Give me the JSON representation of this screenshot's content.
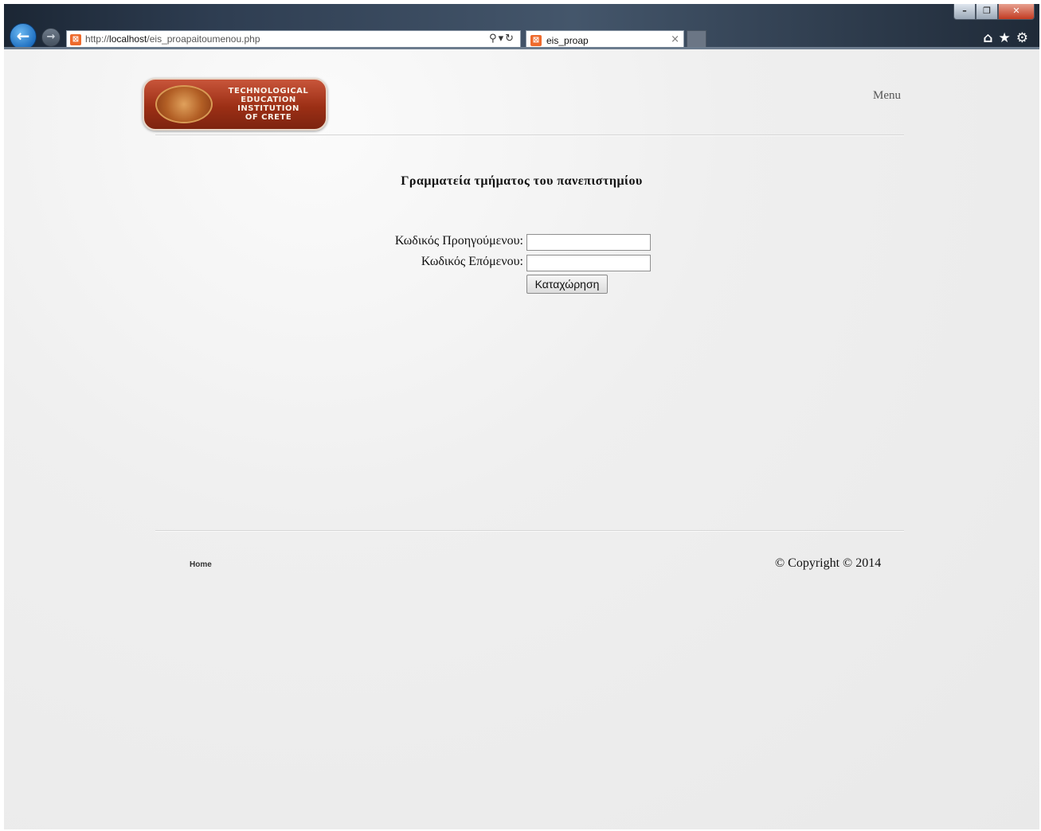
{
  "browser": {
    "address_url_prefix": "http://",
    "address_url_host": "localhost",
    "address_url_path": "/eis_proapaitoumenou.php",
    "tab_title": "eis_proap",
    "tab_close": "×"
  },
  "header": {
    "logo_lines": [
      "TECHNOLOGICAL",
      "EDUCATION",
      "INSTITUTION",
      "OF CRETE"
    ],
    "menu_label": "Menu"
  },
  "main": {
    "title": "Γραμματεία τμήματος του πανεπιστημίου",
    "fields": [
      {
        "label": "Κωδικός Προηγούμενου:",
        "value": ""
      },
      {
        "label": "Κωδικός Επόμενου:",
        "value": ""
      }
    ],
    "submit_label": "Καταχώρηση"
  },
  "footer": {
    "home_link": "Home",
    "copyright": "© Copyright © 2014"
  }
}
